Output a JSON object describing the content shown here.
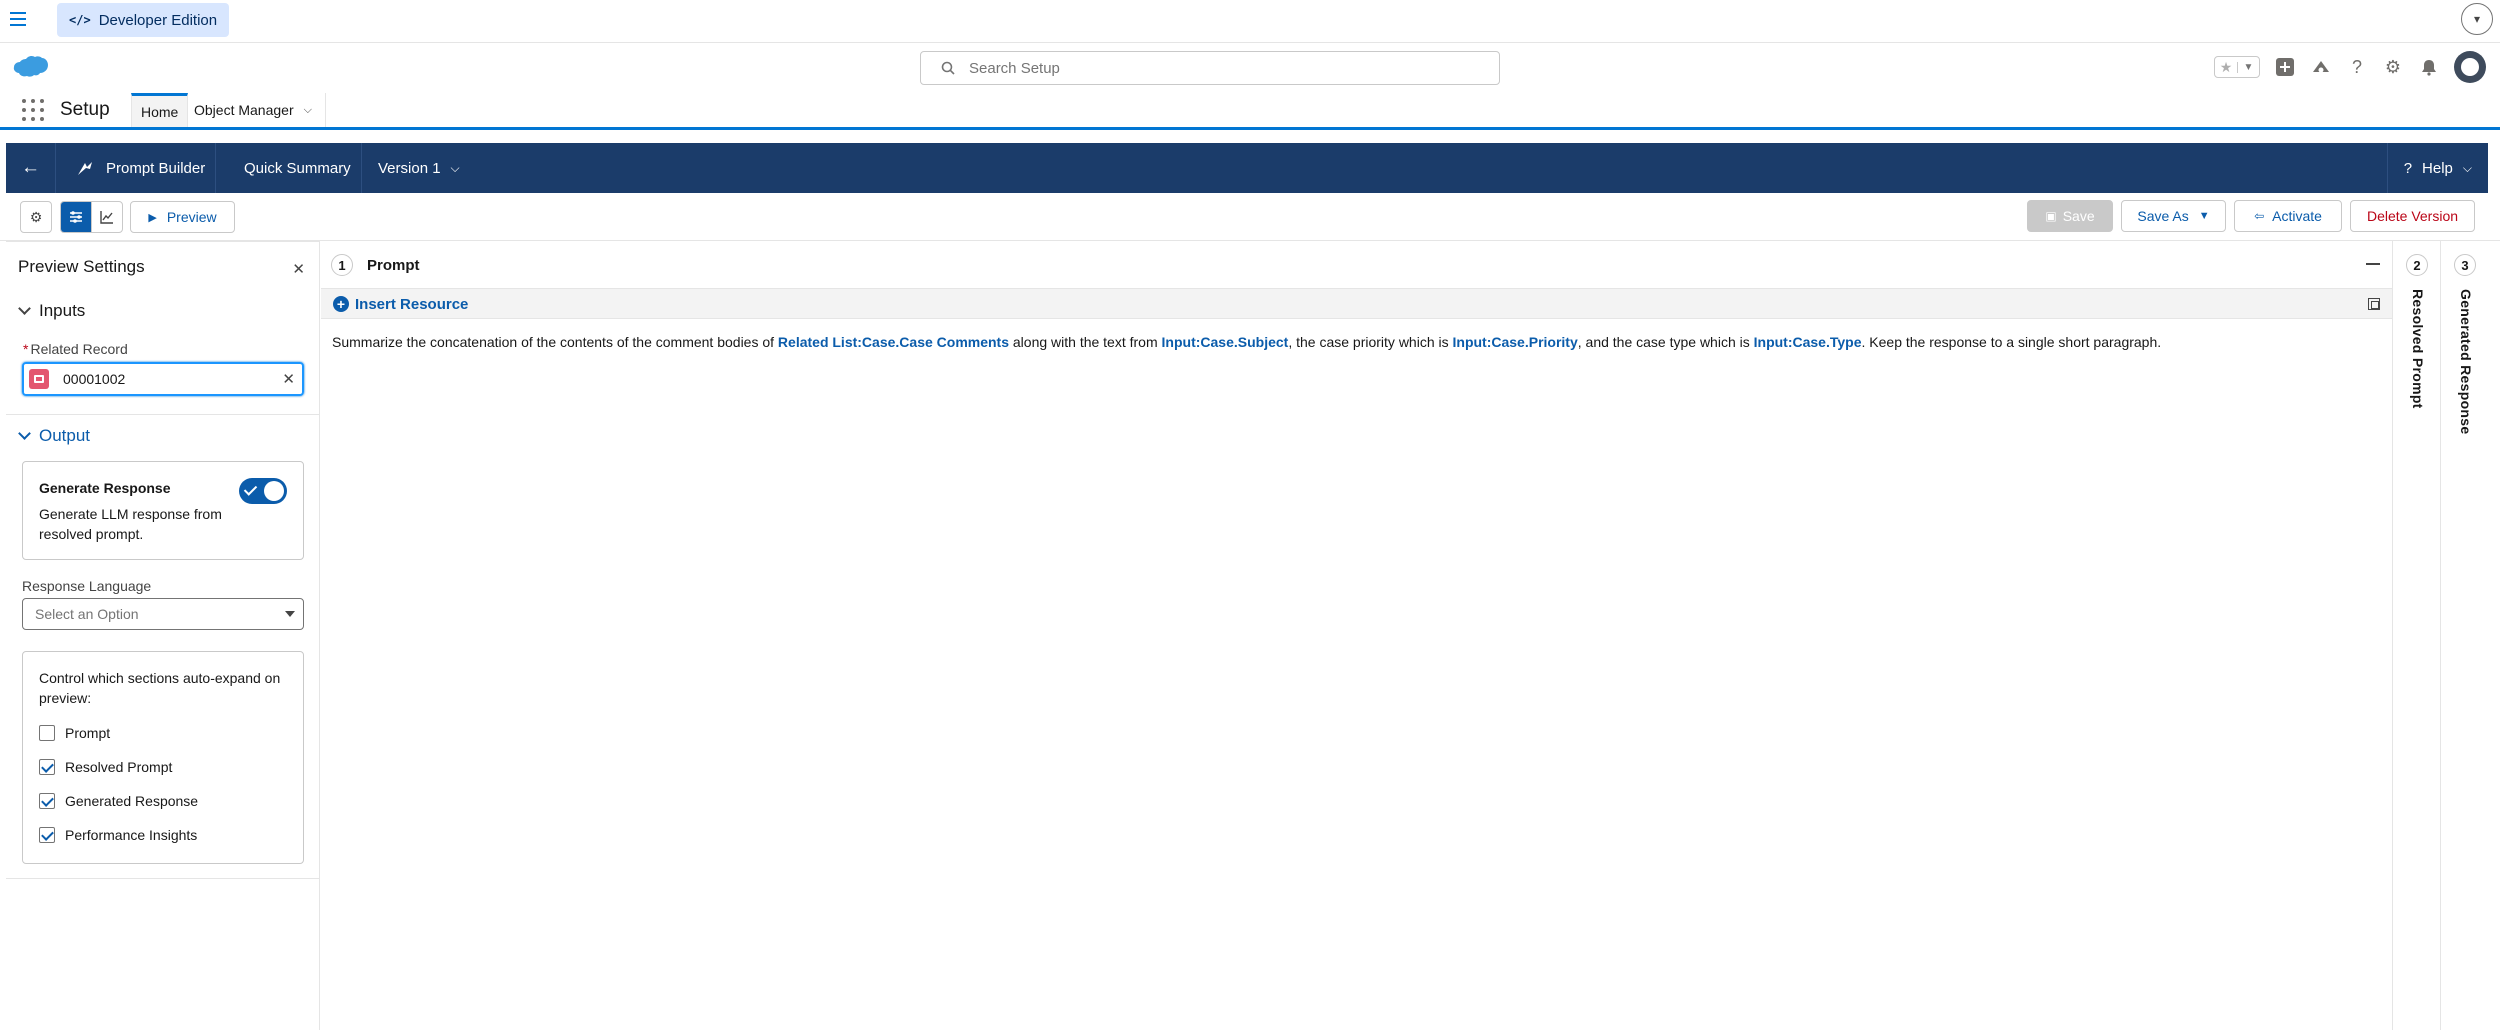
{
  "devbar": {
    "edition_label": "Developer Edition",
    "code_glyph": "</>"
  },
  "header": {
    "search_placeholder": "Search Setup"
  },
  "nav": {
    "app_name": "Setup",
    "tabs": [
      {
        "label": "Home"
      },
      {
        "label": "Object Manager"
      }
    ]
  },
  "builder": {
    "title": "Prompt Builder",
    "template_name": "Quick Summary",
    "version": "Version 1",
    "help": "Help"
  },
  "toolbar": {
    "preview": "Preview",
    "save": "Save",
    "save_as": "Save As",
    "activate": "Activate",
    "delete_version": "Delete Version"
  },
  "preview_settings": {
    "title": "Preview Settings",
    "inputs_heading": "Inputs",
    "related_record_label": "Related Record",
    "related_record_value": "00001002",
    "output_heading": "Output",
    "generate_response_title": "Generate Response",
    "generate_response_desc": "Generate LLM response from resolved prompt.",
    "generate_response_on": true,
    "response_language_label": "Response Language",
    "response_language_placeholder": "Select an Option",
    "expand_text": "Control which sections auto-expand on preview:",
    "checkboxes": [
      {
        "label": "Prompt",
        "checked": false
      },
      {
        "label": "Resolved Prompt",
        "checked": true
      },
      {
        "label": "Generated Response",
        "checked": true
      },
      {
        "label": "Performance Insights",
        "checked": true
      }
    ]
  },
  "prompt_panel": {
    "number": "1",
    "title": "Prompt",
    "insert_resource": "Insert Resource",
    "text_segments": [
      {
        "text": "Summarize the concatenation of the contents of the comment bodies of ",
        "token": false
      },
      {
        "text": "Related List:Case.Case Comments",
        "token": true
      },
      {
        "text": " along with the text from ",
        "token": false
      },
      {
        "text": "Input:Case.Subject",
        "token": true
      },
      {
        "text": ", the case priority which is ",
        "token": false
      },
      {
        "text": "Input:Case.Priority",
        "token": true
      },
      {
        "text": ", and the case type which is ",
        "token": false
      },
      {
        "text": "Input:Case.Type",
        "token": true
      },
      {
        "text": ". Keep the response to a single short paragraph.",
        "token": false
      }
    ]
  },
  "side_panels": [
    {
      "number": "2",
      "title": "Resolved Prompt"
    },
    {
      "number": "3",
      "title": "Generated Response"
    }
  ],
  "colors": {
    "brand_blue": "#0176d3",
    "builder_bar": "#1b3c6a",
    "token_blue": "#0b5cab",
    "delete_red": "#ba0517"
  }
}
